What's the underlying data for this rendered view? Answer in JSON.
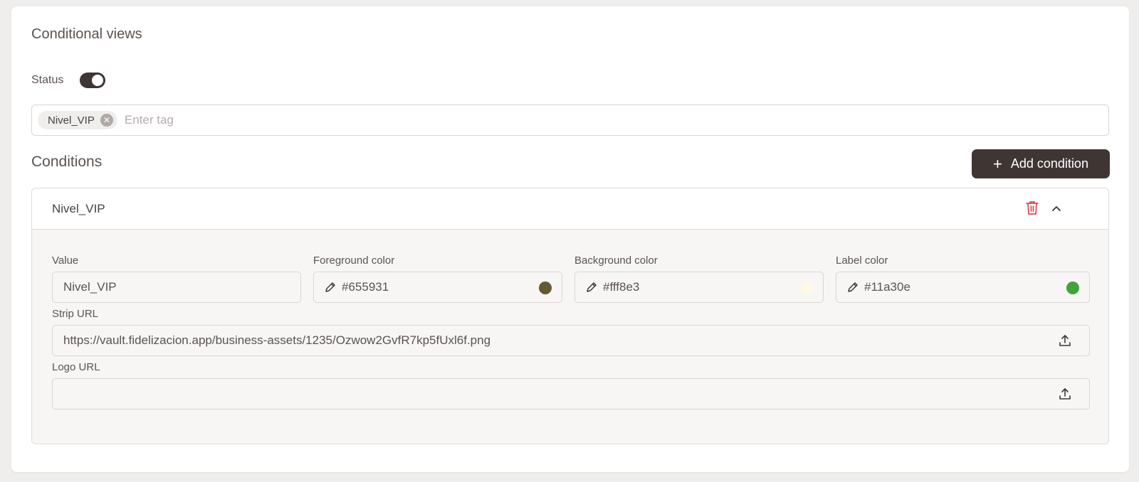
{
  "section": {
    "title": "Conditional views"
  },
  "status": {
    "label": "Status",
    "enabled": true
  },
  "tags": {
    "items": [
      {
        "label": "Nivel_VIP"
      }
    ],
    "placeholder": "Enter tag"
  },
  "conditions": {
    "title": "Conditions",
    "add_button_label": "Add condition",
    "panel": {
      "name": "Nivel_VIP",
      "value": {
        "label": "Value",
        "text": "Nivel_VIP"
      },
      "foreground": {
        "label": "Foreground color",
        "text": "#655931",
        "swatch": "#655931"
      },
      "background": {
        "label": "Background color",
        "text": "#fff8e3",
        "swatch": "#fff8e3"
      },
      "label_color": {
        "label": "Label color",
        "text": "#11a30e",
        "swatch": "#3fa33a"
      },
      "strip_url": {
        "label": "Strip URL",
        "text": "https://vault.fidelizacion.app/business-assets/1235/Ozwow2GvfR7kp5fUxl6f.png"
      },
      "logo_url": {
        "label": "Logo URL",
        "text": ""
      }
    }
  },
  "colors": {
    "primary_dark": "#3f3634",
    "danger": "#d94a4a"
  },
  "icons": [
    "remove-tag-icon",
    "plus-icon",
    "trash-icon",
    "chevron-up-icon",
    "pencil-icon",
    "upload-icon"
  ]
}
